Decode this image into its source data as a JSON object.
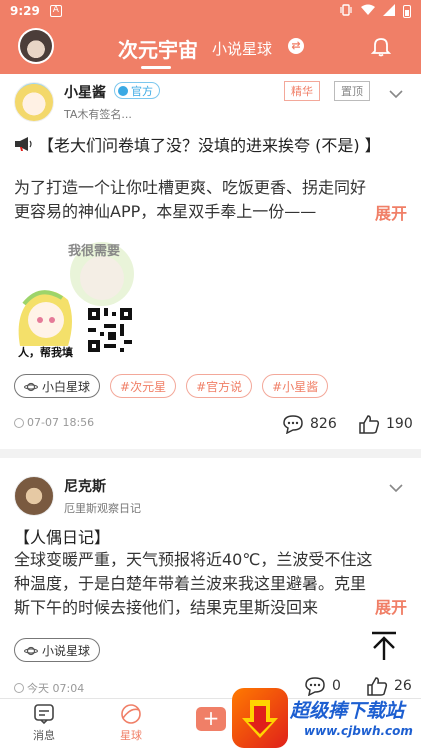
{
  "status_bar": {
    "time": "9:29",
    "left_icon": "A"
  },
  "header": {
    "tab_active": "次元宇宙",
    "tab_other": "小说星球"
  },
  "posts": [
    {
      "username": "小星酱",
      "official_badge": "官方",
      "user_sub": "TA木有签名...",
      "tags": [
        "精华",
        "置顶"
      ],
      "title": "【老大们问卷填了没？没填的进来挨夸 (不是) 】",
      "body": "为了打造一个让你吐槽更爽、吃饭更香、拐走同好更容易的神仙APP，本星双手奉上一份——",
      "expand": "展开",
      "image_text_1": "我很需要",
      "image_text_2": "人，帮我填",
      "circle_chip": "小白星球",
      "topic_chips": [
        "#次元星",
        "#官方说",
        "#小星酱"
      ],
      "time": "07-07 18:56",
      "comments": "826",
      "likes": "190"
    },
    {
      "username": "尼克斯",
      "user_sub": "厄里斯观察日记",
      "title": "【人偶日记】",
      "body": "全球变暖严重，天气预报将近40℃，兰波受不住这种温度，于是白楚年带着兰波来我这里避暑。克里斯下午的时候去接他们，结果克里斯没回来",
      "expand": "展开",
      "circle_chip": "小说星球",
      "time": "今天 07:04",
      "comments": "0",
      "likes": "26"
    }
  ],
  "bottom_nav": {
    "messages": "消息",
    "planet": "星球"
  },
  "watermark": {
    "line1": "超级捧下载站",
    "line2": "www.cjbwh.com"
  },
  "colors": {
    "accent": "#f07f67",
    "official": "#3aa9e4"
  }
}
